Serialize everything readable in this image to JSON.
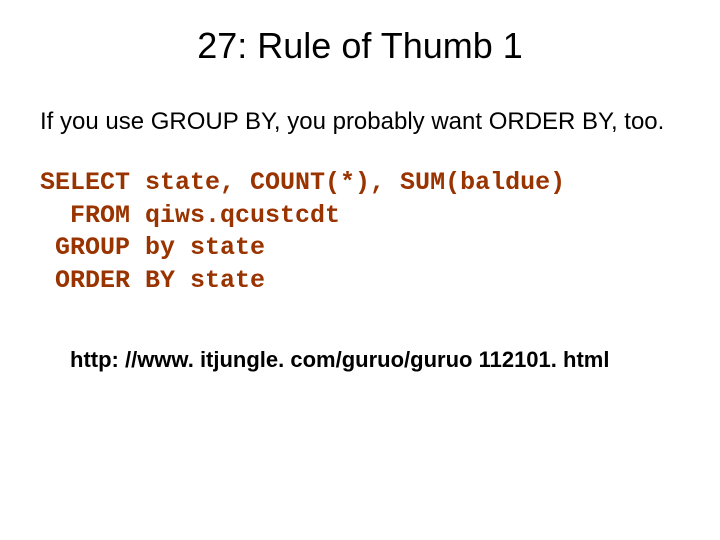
{
  "title": "27: Rule of Thumb 1",
  "body_text": "If you use GROUP BY, you probably want ORDER BY, too.",
  "sql": "SELECT state, COUNT(*), SUM(baldue)\n  FROM qiws.qcustcdt\n GROUP by state\n ORDER BY state",
  "footer": "http: //www. itjungle. com/guruo/guruo 112101. html"
}
